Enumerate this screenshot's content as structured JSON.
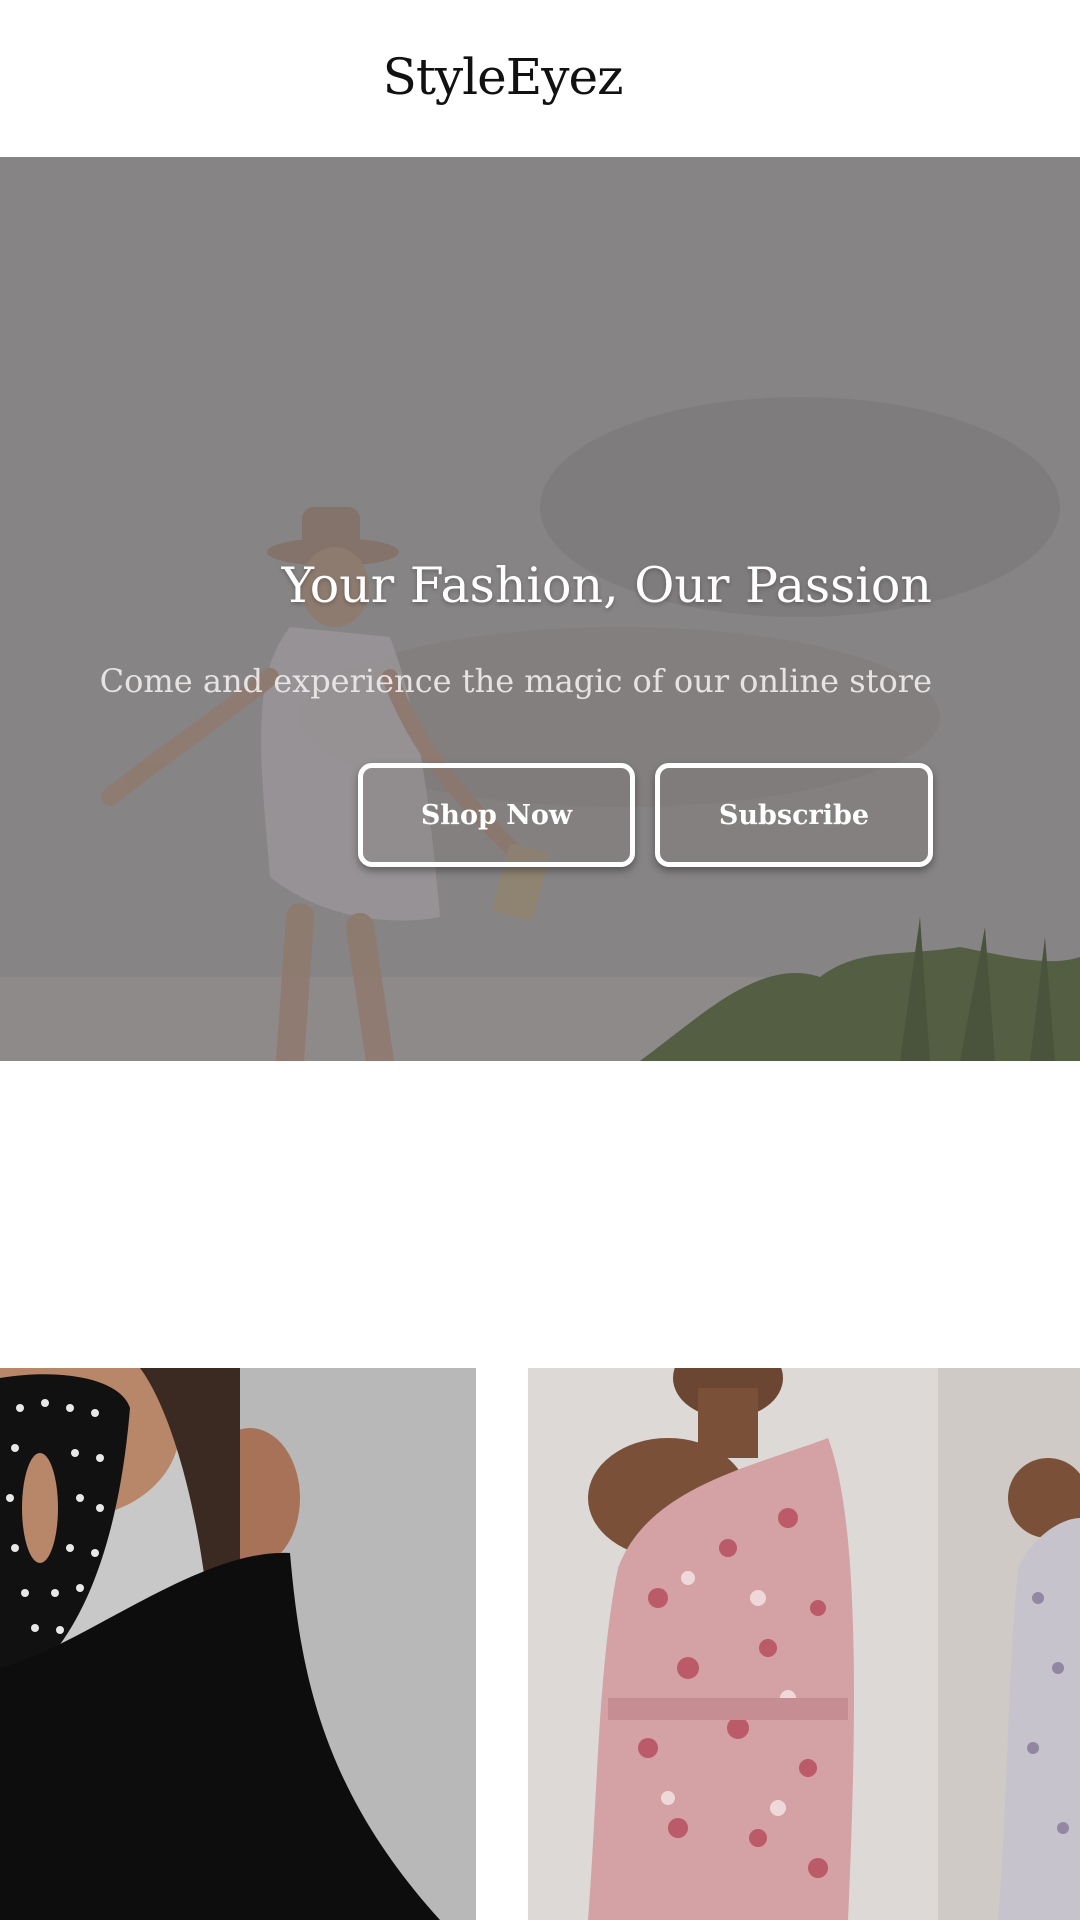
{
  "header": {
    "logo": "StyleEyez"
  },
  "hero": {
    "title": "Your Fashion, Our Passion",
    "subtitle": "Come and experience the magic of our online store",
    "buttons": {
      "shop_now": "Shop Now",
      "subscribe": "Subscribe"
    },
    "image": "woman-in-hat-walking-beach-photo"
  },
  "products": [
    {
      "image": "black-dress-with-embellished-neckline-photo"
    },
    {
      "image": "pink-floral-one-shoulder-dress-photo"
    }
  ],
  "colors": {
    "background": "#ffffff",
    "hero_overlay": "#8c8b8c",
    "text_light": "#ffffff"
  }
}
